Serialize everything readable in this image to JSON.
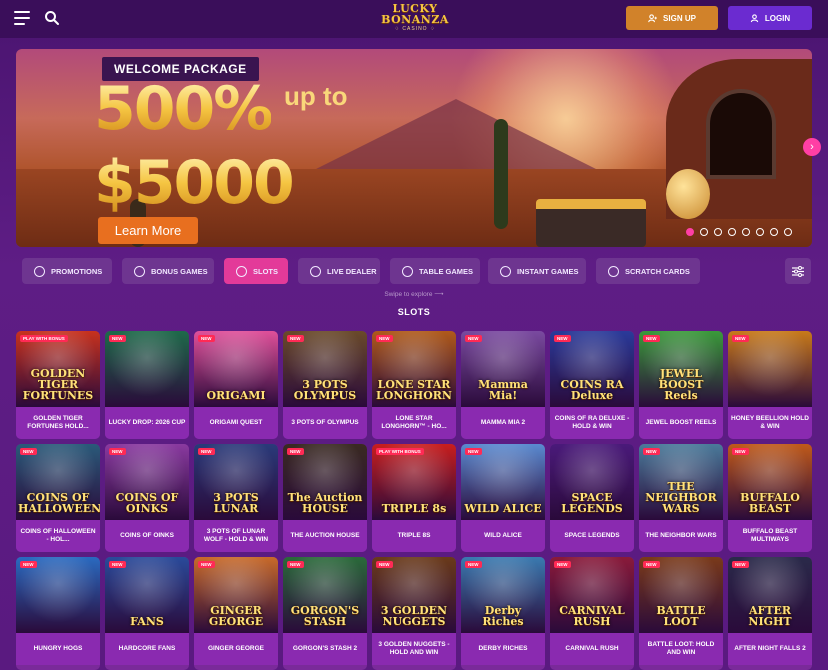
{
  "header": {
    "logo_line1": "LUCKY",
    "logo_line2": "BONANZA",
    "logo_line3": "♢ CASINO ♢",
    "signup_label": "SIGN UP",
    "login_label": "LOGIN"
  },
  "banner": {
    "tag": "WELCOME PACKAGE",
    "headline1": "500%",
    "upto": "up to",
    "headline2": "$5000",
    "cta": "Learn More",
    "dots_count": 8,
    "active_dot": 0
  },
  "tabs": [
    {
      "label": "PROMOTIONS",
      "icon": "promotions-icon",
      "active": false
    },
    {
      "label": "BONUS GAMES",
      "icon": "bonus-icon",
      "active": false
    },
    {
      "label": "SLOTS",
      "icon": "slots-icon",
      "active": true
    },
    {
      "label": "LIVE DEALER",
      "icon": "live-dealer-icon",
      "active": false
    },
    {
      "label": "TABLE GAMES",
      "icon": "table-games-icon",
      "active": false
    },
    {
      "label": "INSTANT GAMES",
      "icon": "instant-games-icon",
      "active": false
    },
    {
      "label": "SCRATCH CARDS",
      "icon": "scratch-cards-icon",
      "active": false
    }
  ],
  "swipe_hint": "Swipe to explore ⟶",
  "section_title": "SLOTS",
  "games": [
    {
      "title": "GOLDEN TIGER FORTUNES HOLD...",
      "art": "GOLDEN TIGER FORTUNES",
      "badge": "PLAY WITH BONUS",
      "bg": "#c8321e"
    },
    {
      "title": "LUCKY DROP: 2026 CUP",
      "art": "",
      "badge": "NEW",
      "bg": "#1e6a4a"
    },
    {
      "title": "ORIGAMI QUEST",
      "art": "ORIGAMI",
      "badge": "NEW",
      "bg": "#e0509a"
    },
    {
      "title": "3 POTS OF OLYMPUS",
      "art": "3 POTS OLYMPUS",
      "badge": "NEW",
      "bg": "#6a4a2a"
    },
    {
      "title": "LONE STAR LONGHORN™ - HO...",
      "art": "LONE STAR LONGHORN",
      "badge": "NEW",
      "bg": "#b05a1a"
    },
    {
      "title": "MAMMA MIA 2",
      "art": "Mamma Mia!",
      "badge": "NEW",
      "bg": "#7a4aa0"
    },
    {
      "title": "COINS OF RA DELUXE - HOLD & WIN",
      "art": "COINS RA Deluxe",
      "badge": "NEW",
      "bg": "#2a3a9a"
    },
    {
      "title": "JEWEL BOOST REELS",
      "art": "JEWEL BOOST Reels",
      "badge": "NEW",
      "bg": "#3a9a3a"
    },
    {
      "title": "HONEY BEELLION HOLD & WIN",
      "art": "",
      "badge": "NEW",
      "bg": "#c87a1a"
    },
    {
      "title": "COINS OF HALLOWEEN - HOL...",
      "art": "COINS OF HALLOWEEN",
      "badge": "NEW",
      "bg": "#2a5a7a"
    },
    {
      "title": "COINS OF OINKS",
      "art": "COINS OF OINKS",
      "badge": "NEW",
      "bg": "#8a3aa0"
    },
    {
      "title": "3 POTS OF LUNAR WOLF - HOLD & WIN",
      "art": "3 POTS LUNAR",
      "badge": "NEW",
      "bg": "#2a3a7a"
    },
    {
      "title": "THE AUCTION HOUSE",
      "art": "The Auction HOUSE",
      "badge": "NEW",
      "bg": "#3a2a22"
    },
    {
      "title": "TRIPLE 8S",
      "art": "TRIPLE 8s",
      "badge": "PLAY WITH BONUS",
      "bg": "#c81e1e"
    },
    {
      "title": "WILD ALICE",
      "art": "WILD ALICE",
      "badge": "NEW",
      "bg": "#5a8ad0"
    },
    {
      "title": "SPACE LEGENDS",
      "art": "SPACE LEGENDS",
      "badge": "",
      "bg": "#4a1a7a"
    },
    {
      "title": "THE NEIGHBOR WARS",
      "art": "THE NEIGHBOR WARS",
      "badge": "NEW",
      "bg": "#4a7a9a"
    },
    {
      "title": "BUFFALO BEAST MULTIWAYS",
      "art": "BUFFALO BEAST",
      "badge": "NEW",
      "bg": "#c05a1a"
    },
    {
      "title": "HUNGRY HOGS",
      "art": "",
      "badge": "NEW",
      "bg": "#2a6ac0"
    },
    {
      "title": "HARDCORE FANS",
      "art": "FANS",
      "badge": "NEW",
      "bg": "#2a4a9a"
    },
    {
      "title": "GINGER GEORGE",
      "art": "GINGER GEORGE",
      "badge": "NEW",
      "bg": "#c86a2a"
    },
    {
      "title": "GORGON'S STASH 2",
      "art": "GORGON'S STASH",
      "badge": "NEW",
      "bg": "#2a6a3a"
    },
    {
      "title": "3 GOLDEN NUGGETS - HOLD AND WIN",
      "art": "3 GOLDEN NUGGETS",
      "badge": "NEW",
      "bg": "#6a3a1a"
    },
    {
      "title": "DERBY RICHES",
      "art": "Derby Riches",
      "badge": "NEW",
      "bg": "#3a7ab0"
    },
    {
      "title": "CARNIVAL RUSH",
      "art": "CARNIVAL RUSH",
      "badge": "NEW",
      "bg": "#8a1a3a"
    },
    {
      "title": "BATTLE LOOT: HOLD AND WIN",
      "art": "BATTLE LOOT",
      "badge": "NEW",
      "bg": "#7a3a1a"
    },
    {
      "title": "AFTER NIGHT FALLS 2",
      "art": "AFTER NIGHT",
      "badge": "NEW",
      "bg": "#2a2a4a"
    }
  ],
  "colors": {
    "accent_pink": "#e33a99",
    "signup_orange": "#d1822a",
    "login_purple": "#6b2bd0",
    "gold": "#f5c542"
  }
}
